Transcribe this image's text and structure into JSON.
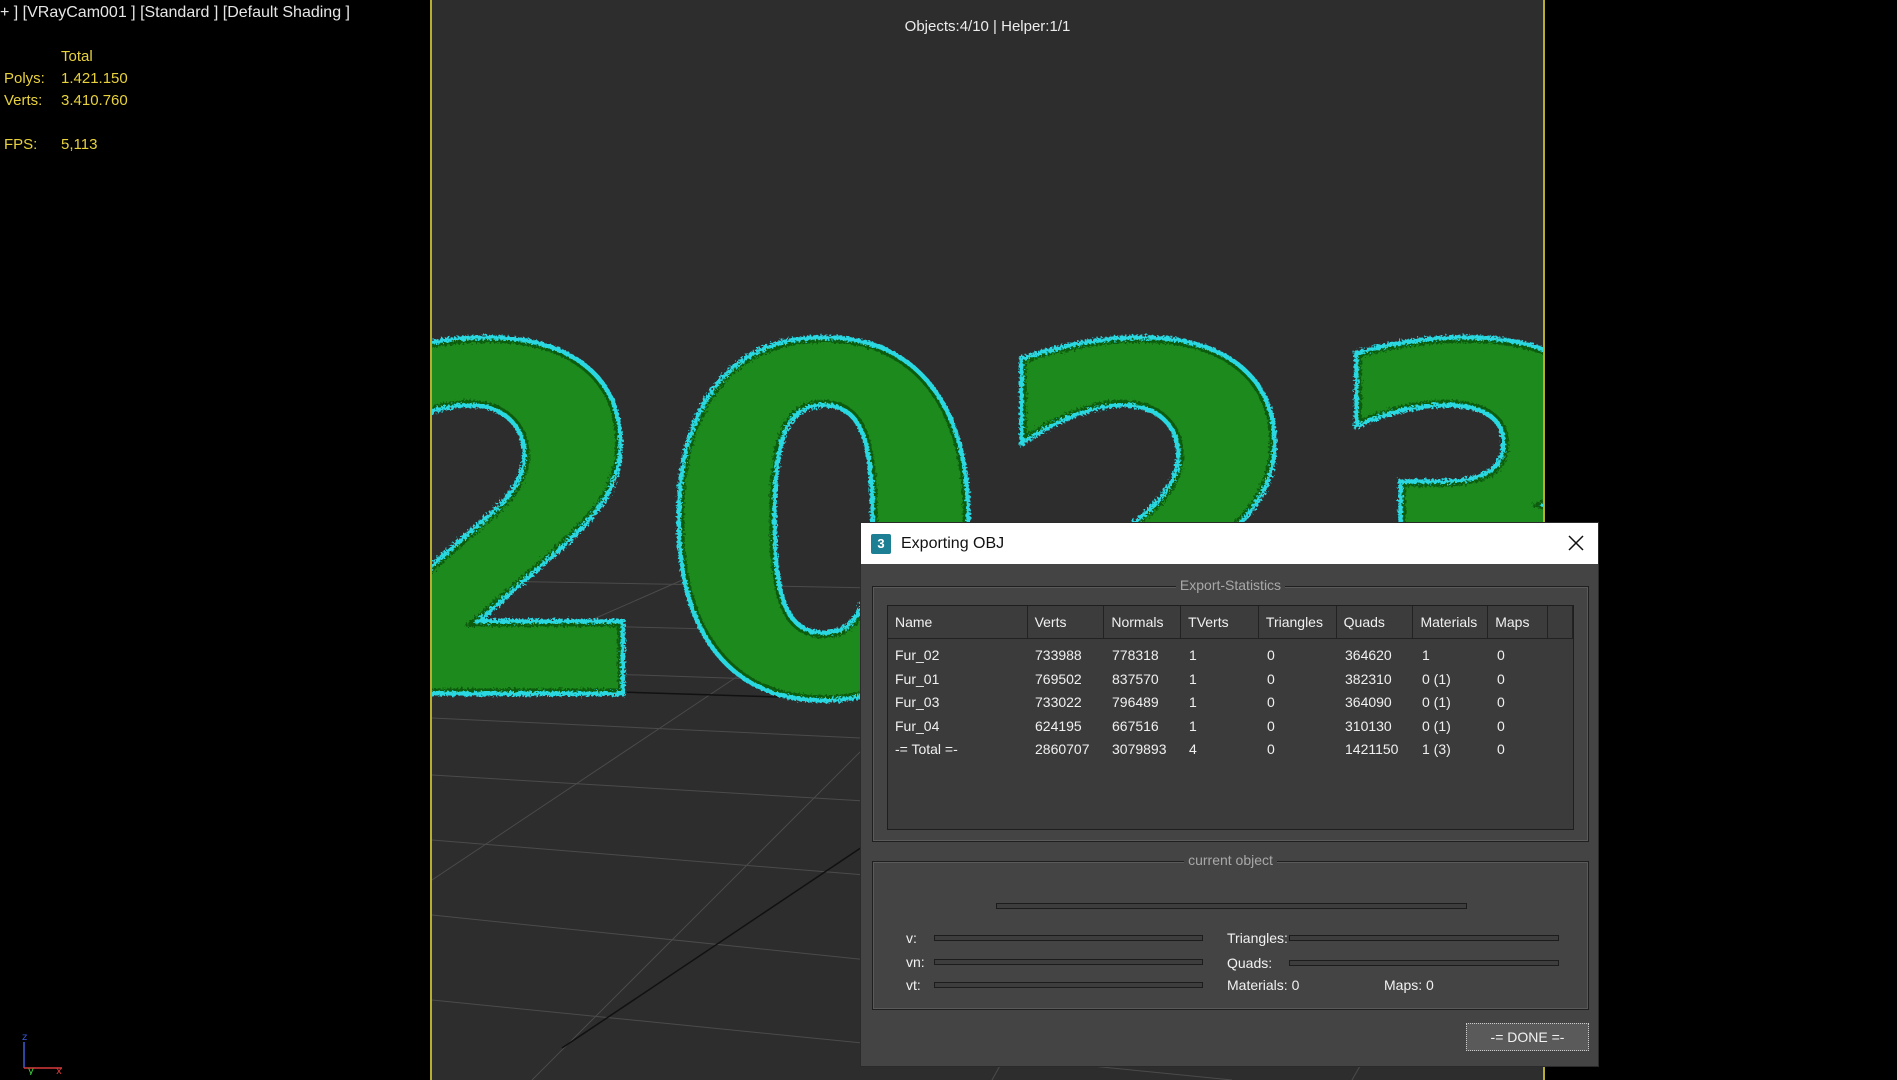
{
  "viewport": {
    "label": "+ ] [VRayCam001 ] [Standard ] [Default Shading ]",
    "object_count": "Objects:4/10 | Helper:1/1",
    "accent_border": "#b8ae2e",
    "scene_text": "2023",
    "stats": {
      "header": "Total",
      "polys_label": "Polys:",
      "polys_value": "1.421.150",
      "verts_label": "Verts:",
      "verts_value": "3.410.760",
      "fps_label": "FPS:",
      "fps_value": "5,113"
    },
    "axis": {
      "z": "z",
      "y": "y",
      "x": "x"
    }
  },
  "dialog": {
    "icon_text": "3",
    "title": "Exporting OBJ",
    "export_stats_legend": "Export-Statistics",
    "columns": [
      "Name",
      "Verts",
      "Normals",
      "TVerts",
      "Triangles",
      "Quads",
      "Materials",
      "Maps",
      ""
    ],
    "rows": [
      [
        "Fur_02",
        "733988",
        "778318",
        "1",
        "0",
        "364620",
        "1",
        "0"
      ],
      [
        "Fur_01",
        "769502",
        "837570",
        "1",
        "0",
        "382310",
        "0 (1)",
        "0"
      ],
      [
        "Fur_03",
        "733022",
        "796489",
        "1",
        "0",
        "364090",
        "0 (1)",
        "0"
      ],
      [
        "Fur_04",
        "624195",
        "667516",
        "1",
        "0",
        "310130",
        "0 (1)",
        "0"
      ],
      [
        "-= Total =-",
        "2860707",
        "3079893",
        "4",
        "0",
        "1421150",
        "1 (3)",
        "0"
      ]
    ],
    "current_object_legend": "current object",
    "v_label": "v:",
    "vn_label": "vn:",
    "vt_label": "vt:",
    "triangles_label": "Triangles:",
    "quads_label": "Quads:",
    "materials_text": "Materials: 0",
    "maps_text": "Maps:  0",
    "done_label": "-= DONE =-"
  }
}
